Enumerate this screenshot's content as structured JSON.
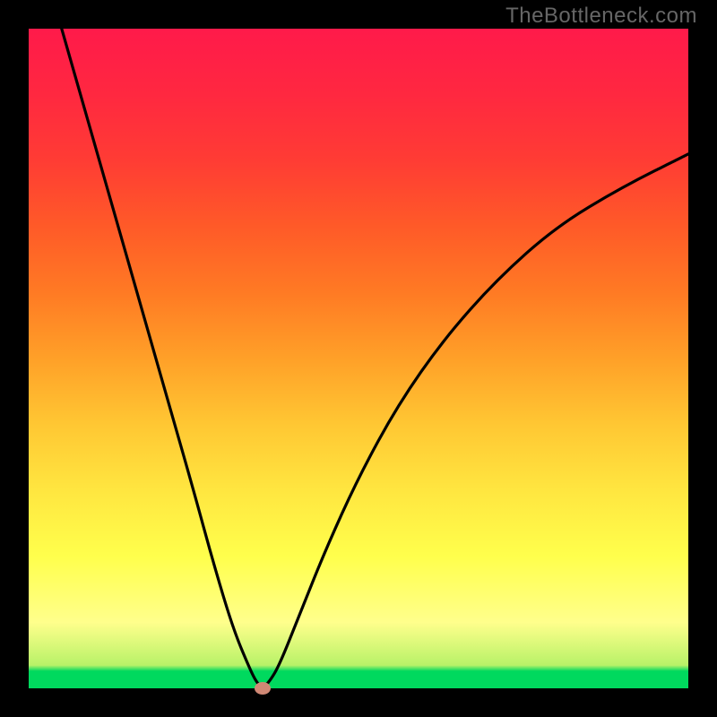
{
  "watermark": "TheBottleneck.com",
  "chart_data": {
    "type": "line",
    "title": "",
    "xlabel": "",
    "ylabel": "",
    "xlim": [
      0,
      100
    ],
    "ylim": [
      0,
      100
    ],
    "series": [
      {
        "name": "curve",
        "x": [
          5,
          9,
          13,
          17,
          21,
          25,
          28,
          31,
          33.5,
          34.5,
          35.4,
          36.5,
          38,
          41,
          45,
          50,
          56,
          63,
          71,
          80,
          90,
          100
        ],
        "values": [
          100,
          86,
          72,
          58,
          44,
          30,
          19,
          9,
          3,
          1,
          0,
          1,
          3.5,
          11,
          21,
          32,
          43,
          53,
          62,
          70,
          76,
          81
        ]
      }
    ],
    "marker": {
      "x": 35.4,
      "y": 0,
      "color": "#d08875"
    },
    "background_gradient": {
      "bottom": "#00d95e",
      "mid": "#ffff4c",
      "top": "#ff1a4a"
    }
  }
}
